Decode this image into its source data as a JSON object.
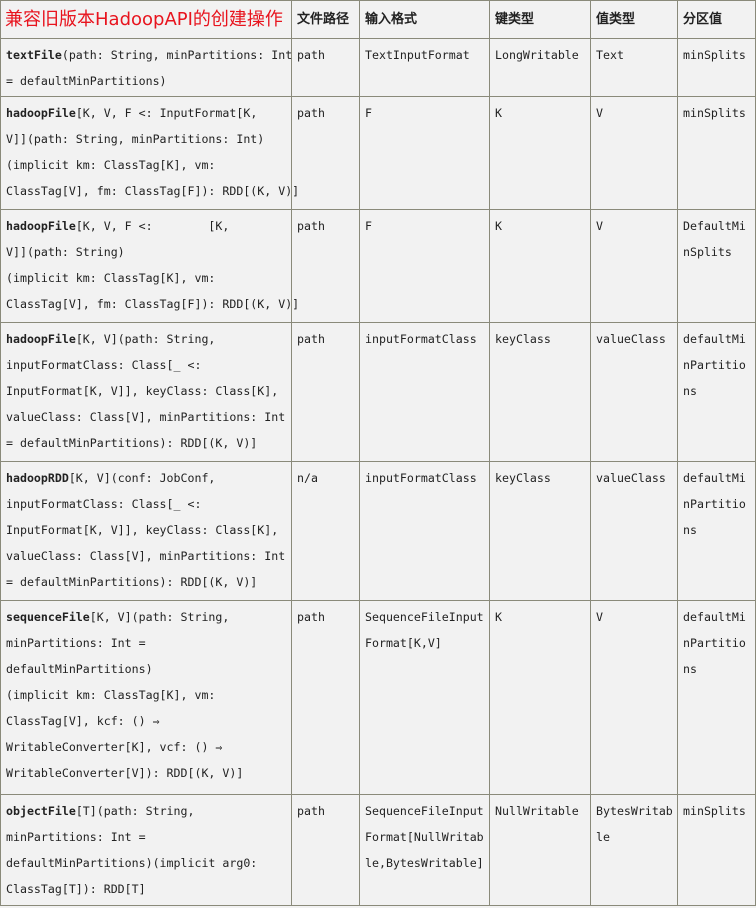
{
  "title": "兼容旧版本HadoopAPI的创建操作",
  "headers": [
    "文件路径",
    "输入格式",
    "键类型",
    "值类型",
    "分区值"
  ],
  "rows": [
    {
      "name": "textFile",
      "lines": [
        "(path: String, minPartitions: Int",
        "= defaultMinPartitions)"
      ],
      "path": "path",
      "format": [
        "TextInputFormat"
      ],
      "key": "LongWritable",
      "value": "Text",
      "partition": [
        "minSplits"
      ]
    },
    {
      "name": "hadoopFile",
      "lines": [
        "[K, V, F <: InputFormat[K,",
        "V]](path: String, minPartitions: Int)",
        "(implicit km: ClassTag[K], vm:",
        "ClassTag[V], fm: ClassTag[F]): RDD[(K, V)]"
      ],
      "path": "path",
      "format": [
        "F"
      ],
      "key": "K",
      "value": "V",
      "partition": [
        "minSplits"
      ]
    },
    {
      "name": "hadoopFile",
      "lines": [
        "[K, V, F <:        [K,",
        "V]](path: String)",
        "(implicit km: ClassTag[K], vm:",
        "ClassTag[V], fm: ClassTag[F]): RDD[(K, V)]"
      ],
      "path": "path",
      "format": [
        "F"
      ],
      "key": "K",
      "value": "V",
      "partition": [
        "DefaultMi",
        "nSplits"
      ]
    },
    {
      "name": "hadoopFile",
      "lines": [
        "[K, V](path: String,",
        "inputFormatClass: Class[_ <:",
        "InputFormat[K, V]], keyClass: Class[K],",
        "valueClass: Class[V], minPartitions: Int",
        "= defaultMinPartitions): RDD[(K, V)]"
      ],
      "path": "path",
      "format": [
        "inputFormatClass"
      ],
      "key": "keyClass",
      "value": "valueClass",
      "partition": [
        "defaultMi",
        "nPartitio",
        "ns"
      ]
    },
    {
      "name": "hadoopRDD",
      "lines": [
        "[K, V](conf: JobConf,",
        "inputFormatClass: Class[_ <:",
        "InputFormat[K, V]], keyClass: Class[K],",
        "valueClass: Class[V], minPartitions: Int",
        "= defaultMinPartitions): RDD[(K, V)]"
      ],
      "path": "n/a",
      "format": [
        "inputFormatClass"
      ],
      "key": "keyClass",
      "value": "valueClass",
      "partition": [
        "defaultMi",
        "nPartitio",
        "ns"
      ]
    },
    {
      "name": "sequenceFile",
      "lines": [
        "[K, V](path: String,",
        "minPartitions: Int =",
        "defaultMinPartitions)",
        "(implicit km: ClassTag[K], vm:",
        "ClassTag[V], kcf: () ⇒",
        "WritableConverter[K], vcf: () ⇒",
        "WritableConverter[V]): RDD[(K, V)]"
      ],
      "path": "path",
      "format": [
        "SequenceFileInput",
        "Format[K,V]"
      ],
      "key": "K",
      "value": "V",
      "partition": [
        "defaultMi",
        "nPartitio",
        "ns"
      ]
    },
    {
      "name": "objectFile",
      "lines": [
        "[T](path: String,",
        "minPartitions: Int =",
        "defaultMinPartitions)(implicit arg0:",
        "ClassTag[T]): RDD[T]"
      ],
      "path": "path",
      "format": [
        "SequenceFileInput",
        "Format[NullWritab",
        "le,BytesWritable]"
      ],
      "key": "NullWritable",
      "value": [
        "BytesWritab",
        "le"
      ],
      "partition": [
        "minSplits"
      ]
    }
  ]
}
